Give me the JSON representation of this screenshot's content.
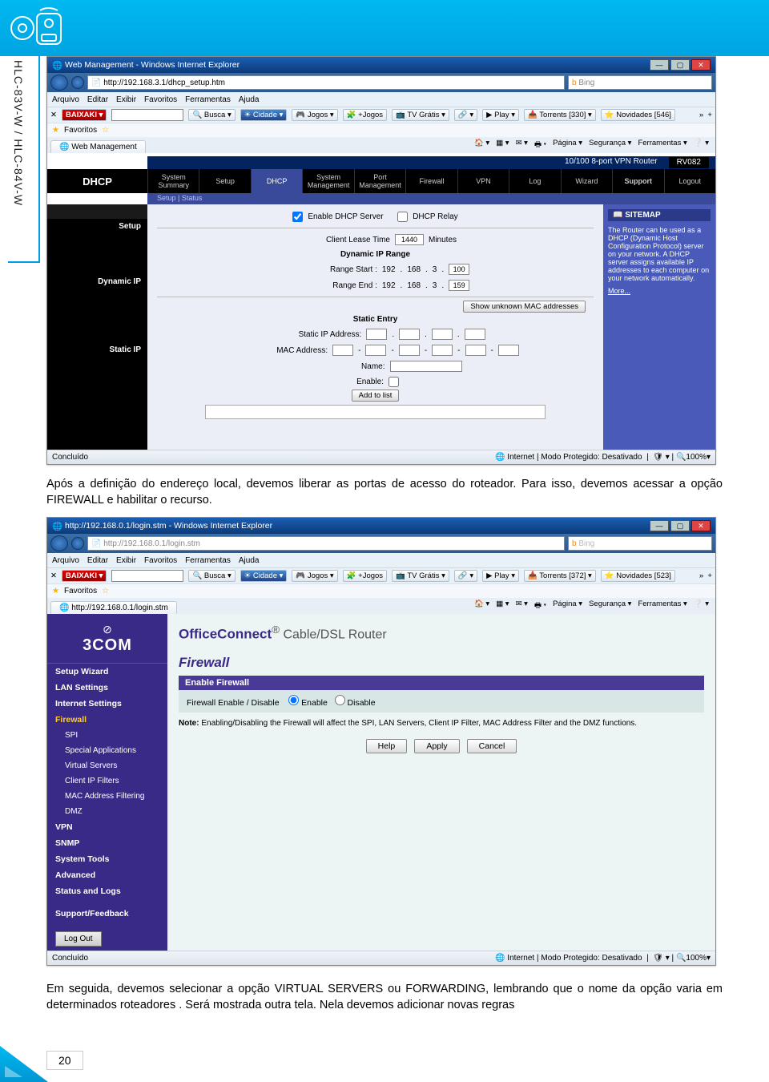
{
  "side_label": "HLC-83V-W / HLC-84V-W",
  "body_text_1": "Após a definição do endereço local, devemos liberar as portas de acesso do roteador. Para isso, devemos acessar a opção FIREWALL e habilitar o recurso.",
  "body_text_2": "Em seguida, devemos selecionar a opção VIRTUAL SERVERS ou FORWARDING, lembrando que o nome da opção varia em determinados roteadores . Será mostrada outra tela. Nela devemos adicionar novas regras",
  "page_number": "20",
  "ss1": {
    "title": "Web Management - Windows Internet Explorer",
    "url": "http://192.168.3.1/dhcp_setup.htm",
    "search_engine": "Bing",
    "menu": [
      "Arquivo",
      "Editar",
      "Exibir",
      "Favoritos",
      "Ferramentas",
      "Ajuda"
    ],
    "toolbar": {
      "busca": "Busca",
      "cidade": "Cidade",
      "jogos": "Jogos",
      "maisjogos": "+Jogos",
      "tvgratis": "TV Grátis",
      "play": "Play",
      "torrents": "Torrents [330]",
      "novidades": "Novidades [546]"
    },
    "fav_label": "Favoritos",
    "tab": "Web Management",
    "tab_tools": {
      "pagina": "Página",
      "seguranca": "Segurança",
      "ferramentas": "Ferramentas"
    },
    "router_title": "10/100 8-port VPN Router",
    "router_model": "RV082",
    "main_tab": "DHCP",
    "tabs": [
      "System Summary",
      "Setup",
      "DHCP",
      "System Management",
      "Port Management",
      "Firewall",
      "VPN",
      "Log",
      "Wizard",
      "Support",
      "Logout"
    ],
    "subtabs": "Setup   |   Status",
    "left_sections": [
      "Setup",
      "Dynamic IP",
      "Static IP"
    ],
    "enable_dhcp": "Enable DHCP Server",
    "dhcp_relay": "DHCP Relay",
    "lease_label": "Client Lease Time",
    "lease_value": "1440",
    "lease_unit": "Minutes",
    "dyn_title": "Dynamic IP Range",
    "range_start_label": "Range Start :",
    "range_start": {
      "a": "192",
      "b": "168",
      "c": "3",
      "d": "100"
    },
    "range_end_label": "Range End :",
    "range_end": {
      "a": "192",
      "b": "168",
      "c": "3",
      "d": "159"
    },
    "show_mac_btn": "Show unknown MAC addresses",
    "static_entry": "Static Entry",
    "static_ip_label": "Static IP Address:",
    "mac_label": "MAC Address:",
    "name_label": "Name:",
    "enable_label": "Enable:",
    "add_btn": "Add to list",
    "sitemap": "SITEMAP",
    "sitemap_text": "The Router can be used as a DHCP (Dynamic Host Configuration Protocol) server on your network. A DHCP server assigns available IP addresses to each computer on your network automatically.",
    "sitemap_more": "More...",
    "status_done": "Concluído",
    "status_mode": "Internet | Modo Protegido: Desativado",
    "status_zoom": "100%"
  },
  "ss2": {
    "title": "http://192.168.0.1/login.stm - Windows Internet Explorer",
    "url": "http://192.168.0.1/login.stm",
    "search_engine": "Bing",
    "menu": [
      "Arquivo",
      "Editar",
      "Exibir",
      "Favoritos",
      "Ferramentas",
      "Ajuda"
    ],
    "toolbar": {
      "busca": "Busca",
      "cidade": "Cidade",
      "jogos": "Jogos",
      "maisjogos": "+Jogos",
      "tvgratis": "TV Grátis",
      "play": "Play",
      "torrents": "Torrents [372]",
      "novidades": "Novidades [523]"
    },
    "fav_label": "Favoritos",
    "tab": "http://192.168.0.1/login.stm",
    "tab_tools": {
      "pagina": "Página",
      "seguranca": "Segurança",
      "ferramentas": "Ferramentas"
    },
    "brand_logo": "3COM",
    "brand": "OfficeConnect",
    "brand_suffix": " Cable/DSL Router",
    "nav": {
      "setup": "Setup Wizard",
      "lan": "LAN Settings",
      "internet": "Internet Settings",
      "firewall": "Firewall",
      "spi": "SPI",
      "special": "Special Applications",
      "virtual": "Virtual Servers",
      "clientip": "Client IP Filters",
      "mac": "MAC Address Filtering",
      "dmz": "DMZ",
      "vpn": "VPN",
      "snmp": "SNMP",
      "tools": "System Tools",
      "advanced": "Advanced",
      "status": "Status and Logs",
      "support": "Support/Feedback",
      "logout": "Log Out"
    },
    "h1": "Firewall",
    "section": "Enable Firewall",
    "fw_label": "Firewall Enable / Disable",
    "opt_enable": "Enable",
    "opt_disable": "Disable",
    "note": "Note: Enabling/Disabling the Firewall will affect the SPI, LAN Servers, Client IP Filter, MAC Address Filter and the DMZ functions.",
    "btn_help": "Help",
    "btn_apply": "Apply",
    "btn_cancel": "Cancel",
    "status_done": "Concluído",
    "status_mode": "Internet | Modo Protegido: Desativado",
    "status_zoom": "100%"
  }
}
